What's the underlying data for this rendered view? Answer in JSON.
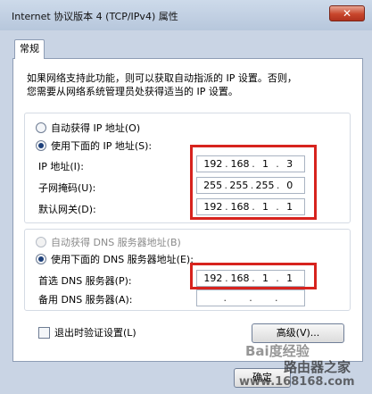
{
  "window": {
    "title": "Internet 协议版本 4 (TCP/IPv4) 属性",
    "close_glyph": "✕"
  },
  "tab_general": "常规",
  "description": {
    "line1": "如果网络支持此功能，则可以获取自动指派的 IP 设置。否则，",
    "line2": "您需要从网络系统管理员处获得适当的 IP 设置。"
  },
  "ip_section": {
    "auto_label": "自动获得 IP 地址(O)",
    "manual_label": "使用下面的 IP 地址(S):",
    "fields": [
      {
        "label": "IP 地址(I):",
        "octets": [
          "192",
          "168",
          "1",
          "3"
        ]
      },
      {
        "label": "子网掩码(U):",
        "octets": [
          "255",
          "255",
          "255",
          "0"
        ]
      },
      {
        "label": "默认网关(D):",
        "octets": [
          "192",
          "168",
          "1",
          "1"
        ]
      }
    ]
  },
  "dns_section": {
    "auto_label": "自动获得 DNS 服务器地址(B)",
    "manual_label": "使用下面的 DNS 服务器地址(E):",
    "preferred": {
      "label": "首选 DNS 服务器(P):",
      "octets": [
        "192",
        "168",
        "1",
        "1"
      ]
    },
    "alternate": {
      "label": "备用 DNS 服务器(A):",
      "octets": [
        "",
        "",
        "",
        ""
      ]
    }
  },
  "validate_label": "退出时验证设置(L)",
  "advanced_button": "高级(V)...",
  "ok_button": "确定",
  "watermark": {
    "baidu": "Bai度经验",
    "site": "路由器之家",
    "url": "www.168168.com"
  },
  "colors": {
    "highlight": "#d7231e",
    "title_bg": "#c8d5e6"
  }
}
